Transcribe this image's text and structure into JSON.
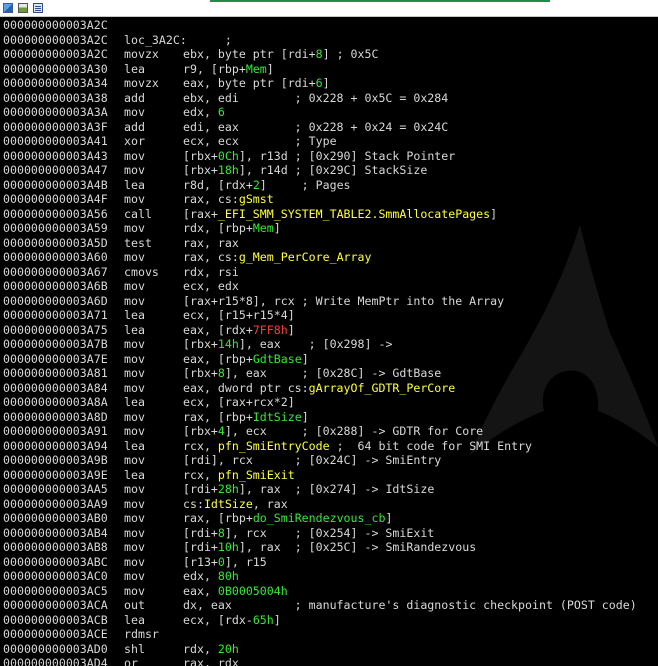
{
  "window": {
    "icons": [
      "app-icon",
      "chart-icon",
      "list-icon"
    ]
  },
  "colors": {
    "background": "#000000",
    "text": "#d8d8d8",
    "immediate": "#35e835",
    "symbol": "#ffff3c",
    "negative_offset": "#ff3a3a",
    "accent": "#1e8c4a"
  },
  "disassembly": {
    "lines": [
      {
        "addr": "000000000003A2C",
        "mn": "",
        "seg": []
      },
      {
        "addr": "000000000003A2C",
        "mn": "loc_3A2C:",
        "seg": [
          {
            "t": "      ;",
            "c": ""
          }
        ]
      },
      {
        "addr": "000000000003A2C",
        "mn": "movzx",
        "seg": [
          {
            "t": "ebx, byte ptr [rdi+",
            "c": ""
          },
          {
            "t": "8",
            "c": "imm"
          },
          {
            "t": "] ; 0x5C",
            "c": ""
          }
        ]
      },
      {
        "addr": "000000000003A30",
        "mn": "lea",
        "seg": [
          {
            "t": "r9, [rbp+",
            "c": ""
          },
          {
            "t": "Mem",
            "c": "imm"
          },
          {
            "t": "]",
            "c": ""
          }
        ]
      },
      {
        "addr": "000000000003A34",
        "mn": "movzx",
        "seg": [
          {
            "t": "eax, byte ptr [rdi+",
            "c": ""
          },
          {
            "t": "6",
            "c": "imm"
          },
          {
            "t": "]",
            "c": ""
          }
        ]
      },
      {
        "addr": "000000000003A38",
        "mn": "add",
        "seg": [
          {
            "t": "ebx, edi        ; 0x228 + 0x5C = 0x284",
            "c": ""
          }
        ]
      },
      {
        "addr": "000000000003A3A",
        "mn": "mov",
        "seg": [
          {
            "t": "edx, ",
            "c": ""
          },
          {
            "t": "6",
            "c": "imm"
          }
        ]
      },
      {
        "addr": "000000000003A3F",
        "mn": "add",
        "seg": [
          {
            "t": "edi, eax        ; 0x228 + 0x24 = 0x24C",
            "c": ""
          }
        ]
      },
      {
        "addr": "000000000003A41",
        "mn": "xor",
        "seg": [
          {
            "t": "ecx, ecx        ; Type",
            "c": ""
          }
        ]
      },
      {
        "addr": "000000000003A43",
        "mn": "mov",
        "seg": [
          {
            "t": "[rbx+",
            "c": ""
          },
          {
            "t": "0Ch",
            "c": "imm"
          },
          {
            "t": "], r13d ; [0x290] Stack Pointer",
            "c": ""
          }
        ]
      },
      {
        "addr": "000000000003A47",
        "mn": "mov",
        "seg": [
          {
            "t": "[rbx+",
            "c": ""
          },
          {
            "t": "18h",
            "c": "imm"
          },
          {
            "t": "], r14d ; [0x29C] StackSize",
            "c": ""
          }
        ]
      },
      {
        "addr": "000000000003A4B",
        "mn": "lea",
        "seg": [
          {
            "t": "r8d, [rdx+",
            "c": ""
          },
          {
            "t": "2",
            "c": "imm"
          },
          {
            "t": "]     ; Pages",
            "c": ""
          }
        ]
      },
      {
        "addr": "000000000003A4F",
        "mn": "mov",
        "seg": [
          {
            "t": "rax, cs:",
            "c": ""
          },
          {
            "t": "gSmst",
            "c": "nm"
          }
        ]
      },
      {
        "addr": "000000000003A56",
        "mn": "call",
        "seg": [
          {
            "t": "[rax+",
            "c": ""
          },
          {
            "t": "_EFI_SMM_SYSTEM_TABLE2.SmmAllocatePages",
            "c": "nm"
          },
          {
            "t": "]",
            "c": ""
          }
        ]
      },
      {
        "addr": "000000000003A59",
        "mn": "mov",
        "seg": [
          {
            "t": "rdx, [rbp+",
            "c": ""
          },
          {
            "t": "Mem",
            "c": "imm"
          },
          {
            "t": "]",
            "c": ""
          }
        ]
      },
      {
        "addr": "000000000003A5D",
        "mn": "test",
        "seg": [
          {
            "t": "rax, rax",
            "c": ""
          }
        ]
      },
      {
        "addr": "000000000003A60",
        "mn": "mov",
        "seg": [
          {
            "t": "rax, cs:",
            "c": ""
          },
          {
            "t": "g_Mem_PerCore_Array",
            "c": "nm"
          }
        ]
      },
      {
        "addr": "000000000003A67",
        "mn": "cmovs",
        "seg": [
          {
            "t": "rdx, rsi",
            "c": ""
          }
        ]
      },
      {
        "addr": "000000000003A6B",
        "mn": "mov",
        "seg": [
          {
            "t": "ecx, edx",
            "c": ""
          }
        ]
      },
      {
        "addr": "000000000003A6D",
        "mn": "mov",
        "seg": [
          {
            "t": "[rax+r15*8], rcx ; Write MemPtr into the Array",
            "c": ""
          }
        ]
      },
      {
        "addr": "000000000003A71",
        "mn": "lea",
        "seg": [
          {
            "t": "ecx, [r15+r15*4]",
            "c": ""
          }
        ]
      },
      {
        "addr": "000000000003A75",
        "mn": "lea",
        "seg": [
          {
            "t": "eax, [rdx+",
            "c": ""
          },
          {
            "t": "7FF8h",
            "c": "neg"
          },
          {
            "t": "]",
            "c": ""
          }
        ]
      },
      {
        "addr": "000000000003A7B",
        "mn": "mov",
        "seg": [
          {
            "t": "[rbx+",
            "c": ""
          },
          {
            "t": "14h",
            "c": "imm"
          },
          {
            "t": "], eax    ; [0x298] ->",
            "c": ""
          }
        ]
      },
      {
        "addr": "000000000003A7E",
        "mn": "mov",
        "seg": [
          {
            "t": "eax, [rbp+",
            "c": ""
          },
          {
            "t": "GdtBase",
            "c": "imm"
          },
          {
            "t": "]",
            "c": ""
          }
        ]
      },
      {
        "addr": "000000000003A81",
        "mn": "mov",
        "seg": [
          {
            "t": "[rbx+",
            "c": ""
          },
          {
            "t": "8",
            "c": "imm"
          },
          {
            "t": "], eax     ; [0x28C] -> GdtBase",
            "c": ""
          }
        ]
      },
      {
        "addr": "000000000003A84",
        "mn": "mov",
        "seg": [
          {
            "t": "eax, dword ptr cs:",
            "c": ""
          },
          {
            "t": "gArrayOf_GDTR_PerCore",
            "c": "nm"
          }
        ]
      },
      {
        "addr": "000000000003A8A",
        "mn": "lea",
        "seg": [
          {
            "t": "ecx, [rax+rcx*2]",
            "c": ""
          }
        ]
      },
      {
        "addr": "000000000003A8D",
        "mn": "mov",
        "seg": [
          {
            "t": "rax, [rbp+",
            "c": ""
          },
          {
            "t": "IdtSize",
            "c": "imm"
          },
          {
            "t": "]",
            "c": ""
          }
        ]
      },
      {
        "addr": "000000000003A91",
        "mn": "mov",
        "seg": [
          {
            "t": "[rbx+",
            "c": ""
          },
          {
            "t": "4",
            "c": "imm"
          },
          {
            "t": "], ecx     ; [0x288] -> GDTR for Core",
            "c": ""
          }
        ]
      },
      {
        "addr": "000000000003A94",
        "mn": "lea",
        "seg": [
          {
            "t": "rcx, ",
            "c": ""
          },
          {
            "t": "pfn_SmiEntryCode",
            "c": "nm"
          },
          {
            "t": " ;  64 bit code for SMI Entry",
            "c": ""
          }
        ]
      },
      {
        "addr": "000000000003A9B",
        "mn": "mov",
        "seg": [
          {
            "t": "[rdi], rcx      ; [0x24C] -> SmiEntry",
            "c": ""
          }
        ]
      },
      {
        "addr": "000000000003A9E",
        "mn": "lea",
        "seg": [
          {
            "t": "rcx, ",
            "c": ""
          },
          {
            "t": "pfn_SmiExit",
            "c": "nm"
          }
        ]
      },
      {
        "addr": "000000000003AA5",
        "mn": "mov",
        "seg": [
          {
            "t": "[rdi+",
            "c": ""
          },
          {
            "t": "28h",
            "c": "imm"
          },
          {
            "t": "], rax  ; [0x274] -> IdtSize",
            "c": ""
          }
        ]
      },
      {
        "addr": "000000000003AA9",
        "mn": "mov",
        "seg": [
          {
            "t": "cs:",
            "c": ""
          },
          {
            "t": "IdtSize",
            "c": "nm"
          },
          {
            "t": ", rax",
            "c": ""
          }
        ]
      },
      {
        "addr": "000000000003AB0",
        "mn": "mov",
        "seg": [
          {
            "t": "rax, [rbp+",
            "c": ""
          },
          {
            "t": "do_SmiRendezvous_cb",
            "c": "imm"
          },
          {
            "t": "]",
            "c": ""
          }
        ]
      },
      {
        "addr": "000000000003AB4",
        "mn": "mov",
        "seg": [
          {
            "t": "[rdi+",
            "c": ""
          },
          {
            "t": "8",
            "c": "imm"
          },
          {
            "t": "], rcx    ; [0x254] -> SmiExit",
            "c": ""
          }
        ]
      },
      {
        "addr": "000000000003AB8",
        "mn": "mov",
        "seg": [
          {
            "t": "[rdi+",
            "c": ""
          },
          {
            "t": "10h",
            "c": "imm"
          },
          {
            "t": "], rax  ; [0x25C] -> SmiRandezvous",
            "c": ""
          }
        ]
      },
      {
        "addr": "000000000003ABC",
        "mn": "mov",
        "seg": [
          {
            "t": "[r13+",
            "c": ""
          },
          {
            "t": "0",
            "c": "imm"
          },
          {
            "t": "], r15",
            "c": ""
          }
        ]
      },
      {
        "addr": "000000000003AC0",
        "mn": "mov",
        "seg": [
          {
            "t": "edx, ",
            "c": ""
          },
          {
            "t": "80h",
            "c": "imm"
          }
        ]
      },
      {
        "addr": "000000000003AC5",
        "mn": "mov",
        "seg": [
          {
            "t": "eax, ",
            "c": ""
          },
          {
            "t": "0B0005004h",
            "c": "imm"
          }
        ]
      },
      {
        "addr": "000000000003ACA",
        "mn": "out",
        "seg": [
          {
            "t": "dx, eax         ; manufacture's diagnostic checkpoint (POST code)",
            "c": ""
          }
        ]
      },
      {
        "addr": "000000000003ACB",
        "mn": "lea",
        "seg": [
          {
            "t": "ecx, [rdx-",
            "c": ""
          },
          {
            "t": "65h",
            "c": "imm"
          },
          {
            "t": "]",
            "c": ""
          }
        ]
      },
      {
        "addr": "000000000003ACE",
        "mn": "rdmsr",
        "seg": []
      },
      {
        "addr": "000000000003AD0",
        "mn": "shl",
        "seg": [
          {
            "t": "rdx, ",
            "c": ""
          },
          {
            "t": "20h",
            "c": "imm"
          }
        ]
      },
      {
        "addr": "000000000003AD4",
        "mn": "or",
        "seg": [
          {
            "t": "rax, rdx",
            "c": ""
          }
        ]
      }
    ]
  }
}
